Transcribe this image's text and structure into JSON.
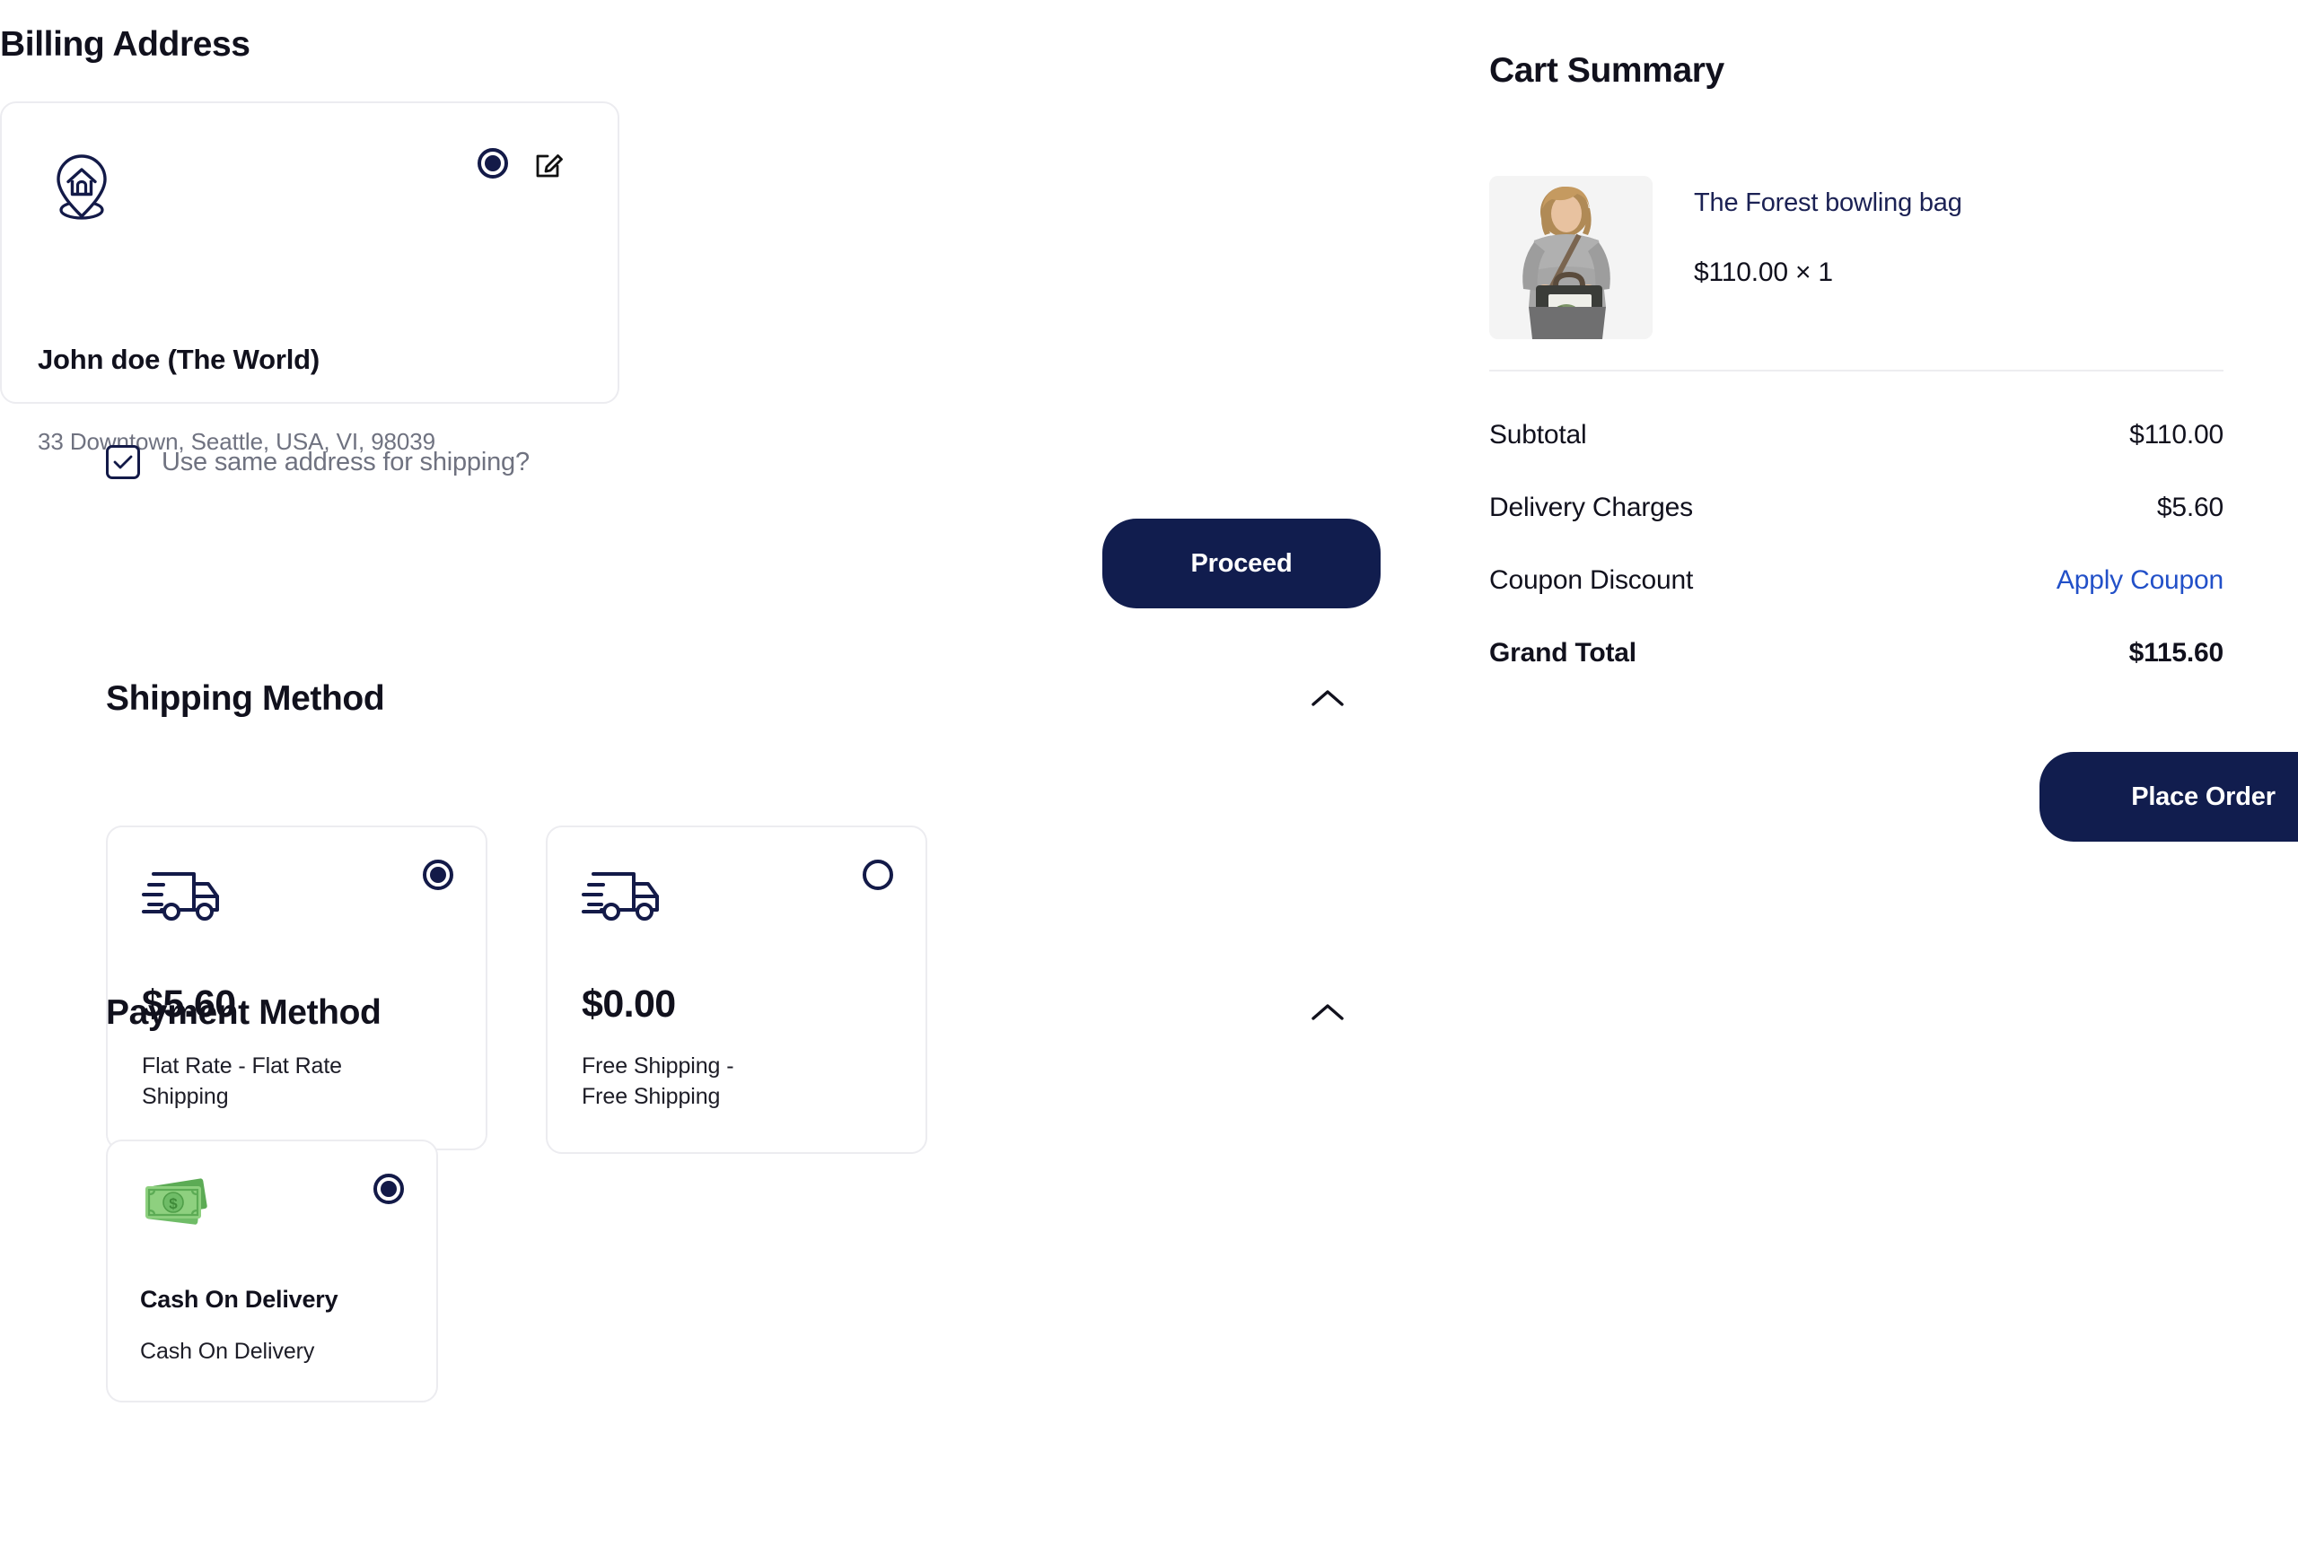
{
  "billing": {
    "title": "Billing Address",
    "address": {
      "name": "John doe (The World)",
      "line": "33 Downtown, Seattle, USA, VI, 98039",
      "selected": true,
      "icon": "home-location-pin-icon",
      "edit_icon": "edit-pencil-icon"
    },
    "same_address_label": "Use same address for shipping?",
    "same_address_checked": true,
    "proceed_label": "Proceed"
  },
  "shipping": {
    "title": "Shipping Method",
    "collapse_icon": "chevron-up-icon",
    "options": [
      {
        "price": "$5.60",
        "label": "Flat Rate - Flat Rate Shipping",
        "selected": true,
        "icon": "delivery-truck-icon"
      },
      {
        "price": "$0.00",
        "label": "Free Shipping - Free Shipping",
        "selected": false,
        "icon": "delivery-truck-icon"
      }
    ]
  },
  "payment": {
    "title": "Payment Method",
    "collapse_icon": "chevron-up-icon",
    "options": [
      {
        "name": "Cash On Delivery",
        "description": "Cash On Delivery",
        "selected": true,
        "icon": "cash-banknotes-icon"
      }
    ]
  },
  "cart": {
    "title": "Cart Summary",
    "item": {
      "name": "The Forest bowling bag",
      "price_qty": "$110.00 × 1",
      "thumbnail_alt": "woman-holding-bowling-bag"
    },
    "totals": [
      {
        "label": "Subtotal",
        "value": "$110.00",
        "is_link": false,
        "bold": false
      },
      {
        "label": "Delivery Charges",
        "value": "$5.60",
        "is_link": false,
        "bold": false
      },
      {
        "label": "Coupon Discount",
        "value": "Apply Coupon",
        "is_link": true,
        "bold": false
      },
      {
        "label": "Grand Total",
        "value": "$115.60",
        "is_link": false,
        "bold": true
      }
    ],
    "place_order_label": "Place Order"
  },
  "colors": {
    "primary_navy": "#111d4e",
    "link_blue": "#2250c8",
    "muted_text": "#6f7280",
    "card_border": "#ececf0",
    "money_green": "#7cc576"
  }
}
